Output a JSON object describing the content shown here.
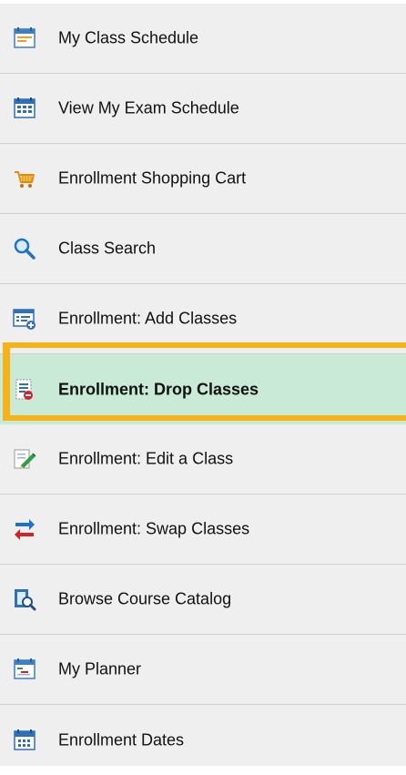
{
  "nav": {
    "items": [
      {
        "label": "My Class Schedule",
        "icon": "calendar-schedule-icon"
      },
      {
        "label": "View My Exam Schedule",
        "icon": "exam-calendar-icon"
      },
      {
        "label": "Enrollment Shopping Cart",
        "icon": "shopping-cart-icon"
      },
      {
        "label": "Class Search",
        "icon": "magnifier-icon"
      },
      {
        "label": "Enrollment:  Add Classes",
        "icon": "add-list-icon"
      },
      {
        "label": "Enrollment:  Drop Classes",
        "icon": "drop-list-icon",
        "active": true
      },
      {
        "label": "Enrollment:  Edit a Class",
        "icon": "edit-pencil-icon"
      },
      {
        "label": "Enrollment:  Swap Classes",
        "icon": "swap-arrows-icon"
      },
      {
        "label": "Browse Course Catalog",
        "icon": "catalog-search-icon"
      },
      {
        "label": "My Planner",
        "icon": "planner-calendar-icon"
      },
      {
        "label": "Enrollment Dates",
        "icon": "dates-calendar-icon"
      }
    ]
  },
  "colors": {
    "background": "#efefef",
    "active_background": "#c9ead6",
    "highlight_border": "#f6b317",
    "divider": "#cfcfcf"
  }
}
